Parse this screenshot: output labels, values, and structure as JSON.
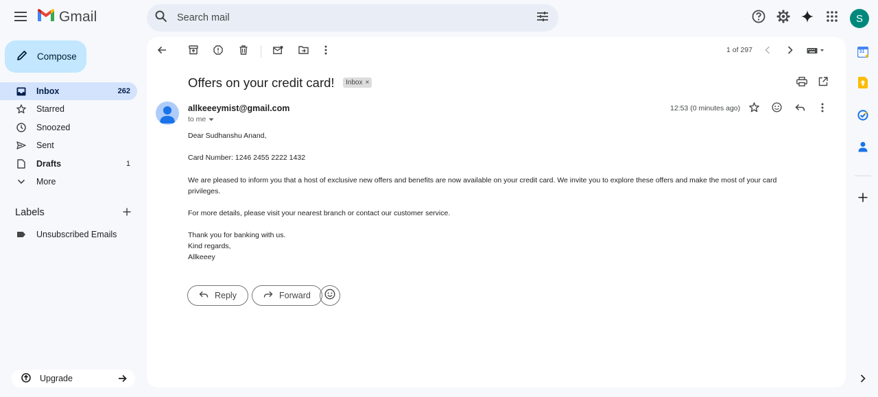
{
  "app": {
    "brand": "Gmail",
    "user_initial": "S",
    "colors": {
      "accent": "#0b57d0",
      "compose_bg": "#c2e7ff",
      "active_nav_bg": "#d3e3fd",
      "avatar_bg": "#00897b",
      "panel_bg": "#f6f8fc"
    }
  },
  "search": {
    "placeholder": "Search mail"
  },
  "topbar_icons": [
    "menu-icon",
    "support-icon",
    "settings-icon",
    "gemini-icon",
    "apps-grid-icon",
    "account-avatar"
  ],
  "compose": {
    "label": "Compose"
  },
  "nav": {
    "items": [
      {
        "label": "Inbox",
        "count": "262",
        "icon": "inbox-icon",
        "active": true
      },
      {
        "label": "Starred",
        "count": "",
        "icon": "star-icon"
      },
      {
        "label": "Snoozed",
        "count": "",
        "icon": "clock-icon"
      },
      {
        "label": "Sent",
        "count": "",
        "icon": "send-icon"
      },
      {
        "label": "Drafts",
        "count": "1",
        "icon": "draft-icon",
        "bold": true
      },
      {
        "label": "More",
        "count": "",
        "icon": "chevron-down-icon"
      }
    ]
  },
  "labels": {
    "heading": "Labels",
    "items": [
      {
        "label": "Unsubscribed Emails",
        "icon": "label-tag-icon"
      }
    ]
  },
  "upgrade": {
    "label": "Upgrade"
  },
  "toolbar": {
    "icons": [
      "back-arrow-icon",
      "archive-icon",
      "report-spam-icon",
      "delete-icon",
      "mark-unread-icon",
      "move-to-icon",
      "more-vert-icon"
    ],
    "pager": "1 of 297",
    "right_icons": [
      "prev-chevron-icon",
      "next-chevron-icon",
      "input-tools-icon"
    ]
  },
  "message": {
    "subject": "Offers on your credit card!",
    "chip": "Inbox",
    "chip_close": "×",
    "sender": "allkeeeymist@gmail.com",
    "to": "to me",
    "time": "12:53 (0 minutes ago)",
    "greeting": "Dear Sudhanshu Anand,",
    "card_line": "Card Number: 1246 2455 2222 1432",
    "paragraph1": "We are pleased to inform you that a host of exclusive new offers and benefits are now available on your credit card. We invite you to explore these offers and make the most of your card privileges.",
    "paragraph2": "For more details, please visit your nearest branch or contact our customer service.",
    "closing1": "Thank you for banking with us.",
    "closing2": "Kind regards,",
    "signature": "Allkeeey"
  },
  "actions": {
    "reply": "Reply",
    "forward": "Forward"
  },
  "side_panel": {
    "calendar_day": "31",
    "icons": [
      "calendar-icon",
      "keep-icon",
      "tasks-icon",
      "contacts-icon",
      "add-addon-icon",
      "expand-panel-icon"
    ]
  }
}
